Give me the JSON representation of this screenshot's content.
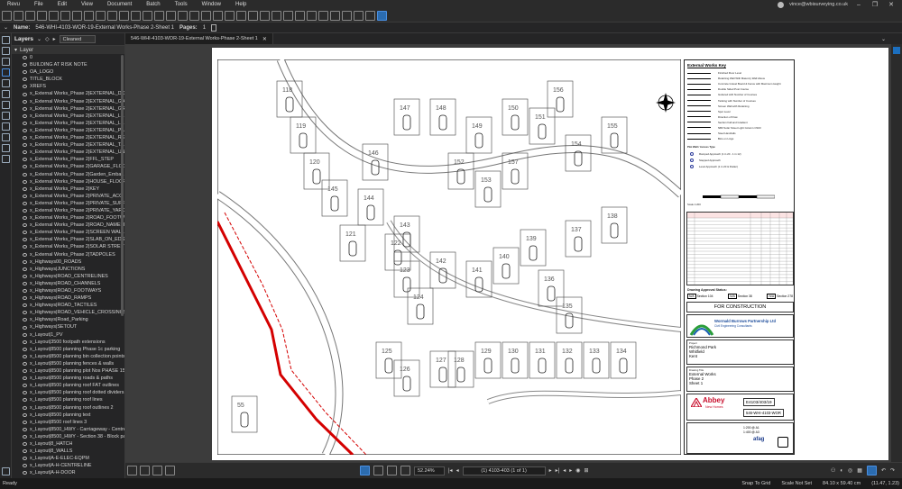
{
  "app": {
    "name": "Revu",
    "menus": [
      "File",
      "Edit",
      "View",
      "Document",
      "Batch",
      "Tools",
      "Window",
      "Help"
    ],
    "user": "vince@wbisurveying.co.uk"
  },
  "properties": {
    "name_label": "Name:",
    "name_value": "546-WHI-4103-WOR-19-External Works-Phase 2-Sheet 1",
    "pages_label": "Pages:",
    "pages_value": "1"
  },
  "layers_panel": {
    "title": "Layers",
    "filter_value": "Cleaned",
    "root_label": "Layer",
    "items": [
      "0",
      "BUILDING AT RISK NOTE",
      "OA_LOGO",
      "TITLE_BLOCK",
      "XREFS",
      "x_External Works_Phase 2|EXTERNAL_DO...",
      "x_External Works_Phase 2|EXTERNAL_GA...",
      "x_External Works_Phase 2|EXTERNAL_GR...",
      "x_External Works_Phase 2|EXTERNAL_LE...",
      "x_External Works_Phase 2|EXTERNAL_LE...",
      "x_External Works_Phase 2|EXTERNAL_PA...",
      "x_External Works_Phase 2|EXTERNAL_RE...",
      "x_External Works_Phase 2|EXTERNAL_TA...",
      "x_External Works_Phase 2|EXTERNAL_UN...",
      "x_External Works_Phase 2|FFL_STEP",
      "x_External Works_Phase 2|GARAGE_FLOO...",
      "x_External Works_Phase 2|Garden_Embar...",
      "x_External Works_Phase 2|HOUSE_FLOOR...",
      "x_External Works_Phase 2|KEY",
      "x_External Works_Phase 2|PRIVATE_ACC...",
      "x_External Works_Phase 2|PRIVATE_SURF...",
      "x_External Works_Phase 2|PRIVATE_YARD...",
      "x_External Works_Phase 2|ROAD_FOOTW...",
      "x_External Works_Phase 2|ROAD_NAMEPL...",
      "x_External Works_Phase 2|SCREEN WALL",
      "x_External Works_Phase 2|SLAB_ON_EDGE",
      "x_External Works_Phase 2|SOLAR STREET...",
      "x_External Works_Phase 2|TADPOLES",
      "x_Highways00_ROADS",
      "x_Highways|JUNCTIONS",
      "x_Highways|ROAD_CENTRELINES",
      "x_Highways|ROAD_CHANNELS",
      "x_Highways|ROAD_FOOTWAYS",
      "x_Highways|ROAD_RAMPS",
      "x_Highways|ROAD_TACTILES",
      "x_Highways|ROAD_VEHICLE_CROSSINGS",
      "x_Highways|Road_Parking",
      "x_Highways|SETOUT",
      "x_Layout|1_PV",
      "x_Layout|3500 footpath extensions",
      "x_Layout|8500 planning Phase 1c parking",
      "x_Layout|8500 planning bin collection points",
      "x_Layout|8500 planning fences & walls",
      "x_Layout|8500 planning plot Nos PHASE 15",
      "x_Layout|8500 planning roads & paths",
      "x_Layout|8500 planning roof FAT outlines",
      "x_Layout|8500 planning roof dotted dividers",
      "x_Layout|8500 planning roof lines",
      "x_Layout|8500 planning roof outlines 2",
      "x_Layout|8500 planning text",
      "x_Layout|8500 roof lines 3",
      "x_Layout|8500_HWY - Carriageway - Centrel...",
      "x_Layout|8500_HWY - Section 38 - Block pa...",
      "x_Layout|8_HATCH",
      "x_Layout|8_WALLS",
      "x_Layout|A-E-ELEC-EQPM",
      "x_Layout|A-H-CENTRELINE",
      "x_Layout|A-H-DOOR"
    ]
  },
  "tab": {
    "label": "546-WHI-4103-WOR-19-External Works-Phase 2-Sheet 1"
  },
  "drawing": {
    "key_title": "External Works Key",
    "key_items": [
      "Finished Floor Level",
      "Retaining Wall With Masonry Wall Above",
      "Concrete Gravel Board & Fence with Maximum Height",
      "Double Sided Post Course",
      "Guttered with Number of Courses",
      "Tanking with Number of Courses",
      "Screen Wall with Retaining",
      "Spot Level",
      "Direction of Flow",
      "Section Fall and Gradient",
      "NB3 Solar Street Light Column CS03",
      "Steel Handrails",
      "Bins on Lings"
    ],
    "access_title": "Plot Wall / Access Type",
    "access_items": [
      "Ramped Approach (1 in 20 - 1 in 12)",
      "Stepped Approach",
      "Level Approach (1 in 20 & Flatter)"
    ],
    "scale_label": "Scale 1:200",
    "approval_label": "Drawing Approval Status:",
    "section_labels": [
      "Section 104",
      "Section 38",
      "Section 278"
    ],
    "status": "FOR CONSTRUCTION",
    "company": "Wormald Burrows Partnership Ltd",
    "company_sub": "Civil Engineering Consultants",
    "project_label": "Project",
    "project": [
      "Richmond Park",
      "Whitfield",
      "Kent"
    ],
    "drawing_title_label": "Drawing Title",
    "drawing_title": [
      "External Works",
      "Phase 2",
      "Sheet 1"
    ],
    "client_brand": "Abbey",
    "client_sub": "New Homes",
    "job_no": "E4103/403/19",
    "drawing_no": "546-WHI-4103-WOR",
    "scale_values": [
      "1:200 @ A1",
      "1:400 @ A3"
    ],
    "cert_brand": "afag",
    "plot_numbers": [
      "118",
      "119",
      "120",
      "121",
      "122",
      "123",
      "124",
      "125",
      "126",
      "127",
      "128",
      "129",
      "130",
      "131",
      "132",
      "133",
      "134",
      "135",
      "136",
      "137",
      "138",
      "139",
      "140",
      "141",
      "142",
      "143",
      "144",
      "145",
      "146",
      "147",
      "148",
      "149",
      "150",
      "151",
      "152",
      "153",
      "154",
      "155",
      "156",
      "157",
      "55"
    ]
  },
  "bottom": {
    "zoom": "52.24%",
    "page": "(1) 4103-403 (1 of 1)"
  },
  "status": {
    "left": "Ready",
    "snap": "Snap To Grid",
    "scale_note": "Scale Not Set",
    "size": "84.10 x 59.40 cm",
    "coords": "(11.47, 1.23)"
  },
  "colors": {
    "accent": "#1c6fbf",
    "background": "#1e1e1e",
    "panel": "#252526",
    "redline": "#d40000"
  }
}
